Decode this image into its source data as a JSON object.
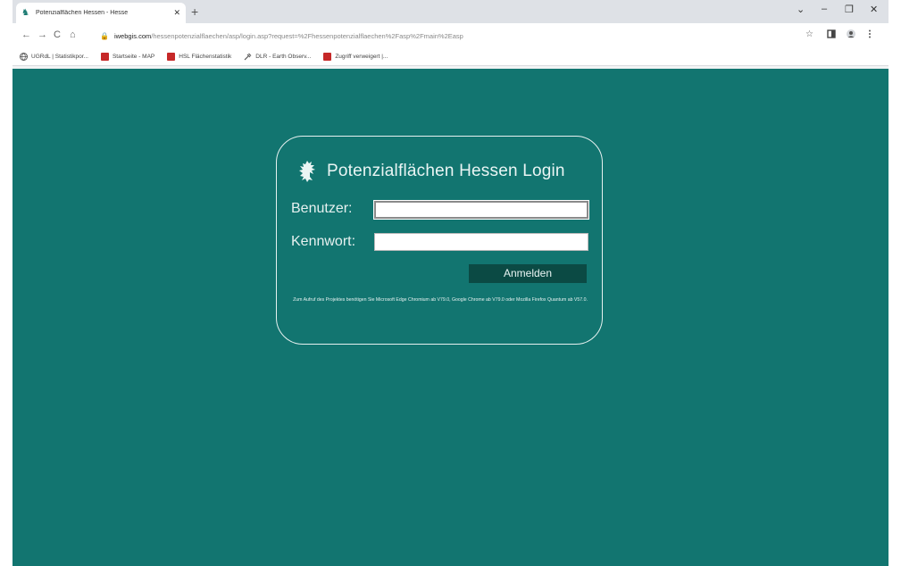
{
  "browser": {
    "tab_title": "Potenzialflächen Hessen - Hesse",
    "tab_close": "✕",
    "new_tab": "+",
    "url_host": "iwebgis.com",
    "url_path": "/hessenpotenzialflaechen/asp/login.asp?request=%2Fhessenpotenzialflaechen%2Fasp%2Fmain%2Easp",
    "nav_back": "←",
    "nav_forward": "→",
    "nav_reload": "C",
    "nav_home": "⌂",
    "lock": "🔒",
    "star": "☆",
    "minimize": "–",
    "restore": "❐",
    "close": "✕",
    "dropdown": "⌄"
  },
  "bookmarks": [
    {
      "label": "UGRdL | Statistikpor...",
      "icon": "globe-icon"
    },
    {
      "label": "Startseite - MAP",
      "icon": "red-square-icon"
    },
    {
      "label": "HSL Flächenstatistik",
      "icon": "red-square-icon"
    },
    {
      "label": "DLR - Earth Observ...",
      "icon": "satellite-icon"
    },
    {
      "label": "Zugriff verweigert |...",
      "icon": "red-square-icon"
    }
  ],
  "login": {
    "title": "Potenzialflächen Hessen Login",
    "user_label": "Benutzer:",
    "password_label": "Kennwort:",
    "user_value": "",
    "password_value": "",
    "submit_label": "Anmelden",
    "note": "Zum Aufruf des Projektes benötigen Sie Microsoft Edge Chromium ab V79.0, Google Chrome ab V79.0 oder Mozilla Firefox Quantum ab V57.0."
  },
  "colors": {
    "page_bg": "#127570",
    "button_bg": "#0b4a44",
    "text": "#eaf5f4"
  }
}
